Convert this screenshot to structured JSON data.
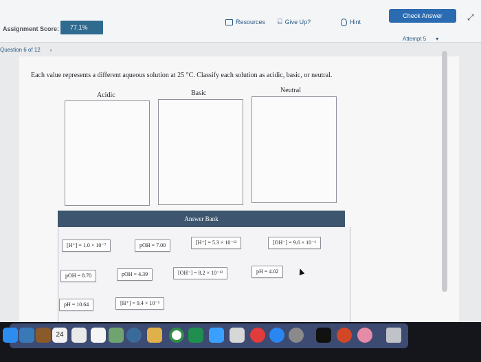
{
  "header": {
    "score_label": "Assignment Score:",
    "score_value": "77.1%",
    "resources_label": "Resources",
    "giveup_label": "Give Up?",
    "hint_label": "Hint",
    "check_answer_label": "Check Answer",
    "attempt_label": "Attempt 5",
    "question_label": "Question 6 of 12"
  },
  "question": {
    "prompt": "Each value represents a different aqueous solution at 25 °C. Classify each solution as acidic, basic, or neutral."
  },
  "bins": [
    {
      "label": "Acidic"
    },
    {
      "label": "Basic"
    },
    {
      "label": "Neutral"
    }
  ],
  "answer_bank": {
    "title": "Answer Bank",
    "tiles": [
      {
        "text": "[H⁺] = 1.0 × 10⁻⁷"
      },
      {
        "text": "pOH = 7.00"
      },
      {
        "text": "[H⁺] = 5.3 × 10⁻¹²"
      },
      {
        "text": "[OH⁻] = 9.6 × 10⁻⁶"
      },
      {
        "text": "pOH = 8.70"
      },
      {
        "text": "pOH = 4.39"
      },
      {
        "text": "[OH⁻] = 8.2 × 10⁻¹³"
      },
      {
        "text": "pH = 4.02"
      },
      {
        "text": "pH = 10.64"
      },
      {
        "text": "[H⁺] = 9.4 × 10⁻⁵"
      }
    ]
  },
  "dock": {
    "calendar_day": "24",
    "icons": [
      "finder-icon",
      "photos-icon",
      "calendar-icon",
      "notes-icon",
      "reminders-icon",
      "photobooth-icon",
      "gamecenter-icon",
      "preview-icon",
      "chrome-icon",
      "numbers-icon",
      "messages-icon",
      "cursor-tool-icon",
      "news-icon",
      "appstore-icon",
      "system-preferences-icon",
      "ios-icon",
      "flashcards-icon",
      "powerpoint-icon",
      "itunes-icon",
      "trash-icon"
    ]
  }
}
